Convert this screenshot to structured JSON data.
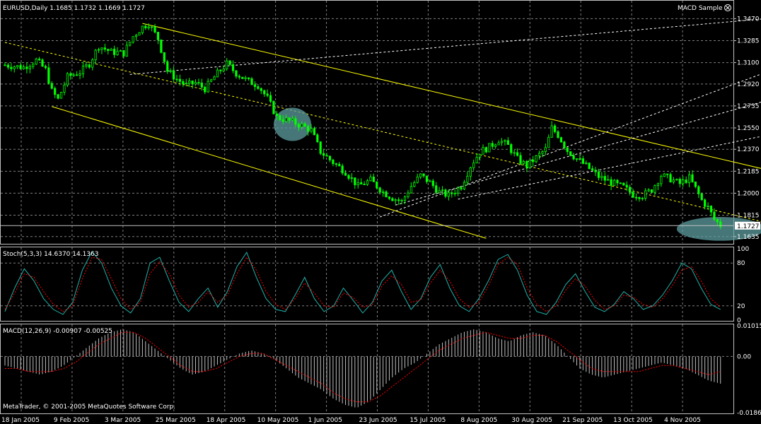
{
  "header": {
    "symbol_line": "EURUSD,Daily  1.1685 1.1732 1.1669 1.1727",
    "ea_label": "MACD Sample"
  },
  "footer": {
    "copyright": "MetaTrader, © 2001-2005 MetaQuotes Software Corp."
  },
  "colors": {
    "background": "#000000",
    "grid": "#7f7f7f",
    "candle": "#00ff00",
    "channel": "#ffff00",
    "stoch_main": "#20b2aa",
    "stoch_signal": "#ff0000",
    "macd_hist": "#c0c0c0",
    "macd_signal": "#ff0000",
    "highlight": "#5f9ea0",
    "price_line": "#c0c0c0"
  },
  "chart_data": [
    {
      "type": "candlestick",
      "title": "EURUSD,Daily",
      "ohlc_last": {
        "open": 1.1685,
        "high": 1.1732,
        "low": 1.1669,
        "close": 1.1727
      },
      "current_price_label": "1.1727",
      "y_ticks": [
        "1.3470",
        "1.3285",
        "1.3100",
        "1.2920",
        "1.2735",
        "1.2550",
        "1.2370",
        "1.2185",
        "1.2000",
        "1.1815",
        "1.1635"
      ],
      "ylim": [
        1.158,
        1.352
      ],
      "x_tick_labels": [
        "18 Jan 2005",
        "9 Feb 2005",
        "3 Mar 2005",
        "25 Mar 2005",
        "18 Apr 2005",
        "10 May 2005",
        "1 Jun 2005",
        "23 Jun 2005",
        "15 Jul 2005",
        "8 Aug 2005",
        "30 Aug 2005",
        "21 Sep 2005",
        "13 Oct 2005",
        "4 Nov 2005"
      ],
      "close_path": [
        [
          0,
          1.308
        ],
        [
          6,
          1.306
        ],
        [
          10,
          1.312
        ],
        [
          13,
          1.304
        ],
        [
          15,
          1.286
        ],
        [
          17,
          1.279
        ],
        [
          20,
          1.298
        ],
        [
          24,
          1.302
        ],
        [
          27,
          1.309
        ],
        [
          30,
          1.324
        ],
        [
          34,
          1.319
        ],
        [
          38,
          1.318
        ],
        [
          41,
          1.332
        ],
        [
          44,
          1.34
        ],
        [
          46,
          1.343
        ],
        [
          49,
          1.33
        ],
        [
          52,
          1.303
        ],
        [
          55,
          1.296
        ],
        [
          58,
          1.291
        ],
        [
          61,
          1.293
        ],
        [
          64,
          1.288
        ],
        [
          68,
          1.301
        ],
        [
          71,
          1.309
        ],
        [
          74,
          1.301
        ],
        [
          78,
          1.294
        ],
        [
          81,
          1.291
        ],
        [
          84,
          1.28
        ],
        [
          87,
          1.264
        ],
        [
          91,
          1.261
        ],
        [
          95,
          1.257
        ],
        [
          98,
          1.253
        ],
        [
          101,
          1.235
        ],
        [
          105,
          1.226
        ],
        [
          109,
          1.218
        ],
        [
          113,
          1.206
        ],
        [
          117,
          1.211
        ],
        [
          121,
          1.201
        ],
        [
          124,
          1.196
        ],
        [
          127,
          1.193
        ],
        [
          130,
          1.206
        ],
        [
          133,
          1.215
        ],
        [
          136,
          1.209
        ],
        [
          139,
          1.201
        ],
        [
          142,
          1.198
        ],
        [
          146,
          1.206
        ],
        [
          149,
          1.223
        ],
        [
          152,
          1.235
        ],
        [
          155,
          1.239
        ],
        [
          158,
          1.245
        ],
        [
          161,
          1.24
        ],
        [
          164,
          1.229
        ],
        [
          167,
          1.223
        ],
        [
          170,
          1.23
        ],
        [
          173,
          1.237
        ],
        [
          175,
          1.255
        ],
        [
          177,
          1.249
        ],
        [
          180,
          1.236
        ],
        [
          183,
          1.229
        ],
        [
          186,
          1.223
        ],
        [
          190,
          1.214
        ],
        [
          194,
          1.209
        ],
        [
          198,
          1.205
        ],
        [
          201,
          1.199
        ],
        [
          204,
          1.198
        ],
        [
          207,
          1.203
        ],
        [
          210,
          1.215
        ],
        [
          213,
          1.212
        ],
        [
          216,
          1.208
        ],
        [
          219,
          1.213
        ],
        [
          221,
          1.204
        ],
        [
          223,
          1.194
        ],
        [
          225,
          1.188
        ],
        [
          227,
          1.178
        ],
        [
          229,
          1.173
        ]
      ],
      "channel_lines": [
        {
          "name": "upper",
          "from": [
            44,
            1.343
          ],
          "to": [
            305,
            1.182
          ]
        },
        {
          "name": "lower",
          "from": [
            15,
            1.273
          ],
          "to": [
            154,
            1.162
          ]
        },
        {
          "name": "median",
          "from": [
            0,
            1.327
          ],
          "to": [
            265,
            1.162
          ],
          "dashed": true
        }
      ],
      "highlight_ellipses": [
        {
          "center": [
            92,
            1.258
          ],
          "rx_days": 6,
          "ry_price": 0.014
        },
        {
          "center": [
            229,
            1.17
          ],
          "rx_days": 14,
          "ry_price": 0.01
        }
      ]
    },
    {
      "type": "line",
      "title": "Stoch(5,3,3) 14.6370 14.1363",
      "y_ticks": [
        "100",
        "80",
        "20",
        "0"
      ],
      "ylim": [
        0,
        100
      ],
      "series": [
        {
          "name": "main",
          "values": [
            12,
            45,
            72,
            55,
            30,
            15,
            8,
            25,
            70,
            96,
            80,
            45,
            20,
            10,
            30,
            80,
            88,
            55,
            25,
            12,
            30,
            45,
            18,
            40,
            75,
            95,
            60,
            30,
            15,
            12,
            35,
            60,
            30,
            12,
            20,
            45,
            28,
            10,
            25,
            55,
            70,
            40,
            15,
            30,
            60,
            78,
            45,
            20,
            12,
            30,
            55,
            85,
            92,
            70,
            35,
            12,
            8,
            25,
            50,
            65,
            40,
            18,
            12,
            22,
            40,
            30,
            15,
            20,
            35,
            55,
            80,
            72,
            45,
            22,
            15
          ]
        },
        {
          "name": "signal",
          "values": [
            15,
            38,
            65,
            60,
            40,
            22,
            12,
            20,
            58,
            88,
            85,
            58,
            30,
            15,
            25,
            65,
            82,
            65,
            35,
            18,
            25,
            40,
            25,
            35,
            65,
            88,
            70,
            40,
            22,
            15,
            30,
            52,
            38,
            20,
            18,
            38,
            32,
            18,
            22,
            48,
            62,
            50,
            25,
            28,
            52,
            70,
            55,
            30,
            18,
            25,
            48,
            78,
            88,
            78,
            45,
            22,
            12,
            20,
            42,
            58,
            48,
            28,
            15,
            20,
            35,
            32,
            22,
            18,
            30,
            48,
            70,
            75,
            55,
            30,
            18
          ]
        }
      ]
    },
    {
      "type": "bar",
      "title": "MACD(12,26,9) -0.00907 -0.00525",
      "y_ticks": [
        "0.01015",
        "0.00",
        "-0.0186"
      ],
      "ylim": [
        -0.0186,
        0.01015
      ],
      "series": [
        {
          "name": "histogram",
          "values": [
            -0.003,
            -0.004,
            -0.005,
            -0.006,
            -0.005,
            -0.003,
            0.0,
            0.003,
            0.006,
            0.008,
            0.009,
            0.008,
            0.005,
            0.002,
            -0.001,
            -0.004,
            -0.006,
            -0.005,
            -0.003,
            -0.001,
            0.001,
            0.002,
            0.001,
            -0.001,
            -0.004,
            -0.007,
            -0.009,
            -0.011,
            -0.014,
            -0.016,
            -0.017,
            -0.015,
            -0.011,
            -0.007,
            -0.004,
            -0.002,
            0.001,
            0.004,
            0.006,
            0.008,
            0.009,
            0.008,
            0.006,
            0.005,
            0.007,
            0.008,
            0.007,
            0.004,
            0.0,
            -0.004,
            -0.006,
            -0.007,
            -0.006,
            -0.005,
            -0.004,
            -0.003,
            -0.002,
            -0.003,
            -0.004,
            -0.006,
            -0.008,
            -0.009
          ]
        },
        {
          "name": "signal",
          "values": [
            -0.004,
            -0.004,
            -0.005,
            -0.005,
            -0.005,
            -0.004,
            -0.002,
            0.001,
            0.004,
            0.006,
            0.008,
            0.008,
            0.006,
            0.003,
            0.0,
            -0.003,
            -0.005,
            -0.005,
            -0.004,
            -0.002,
            0.0,
            0.001,
            0.001,
            -0.001,
            -0.003,
            -0.005,
            -0.007,
            -0.009,
            -0.012,
            -0.014,
            -0.015,
            -0.015,
            -0.013,
            -0.01,
            -0.007,
            -0.004,
            -0.001,
            0.002,
            0.004,
            0.006,
            0.007,
            0.008,
            0.007,
            0.006,
            0.006,
            0.007,
            0.007,
            0.005,
            0.002,
            -0.001,
            -0.004,
            -0.005,
            -0.005,
            -0.005,
            -0.005,
            -0.004,
            -0.003,
            -0.003,
            -0.004,
            -0.005,
            -0.006,
            -0.005
          ]
        }
      ]
    }
  ]
}
